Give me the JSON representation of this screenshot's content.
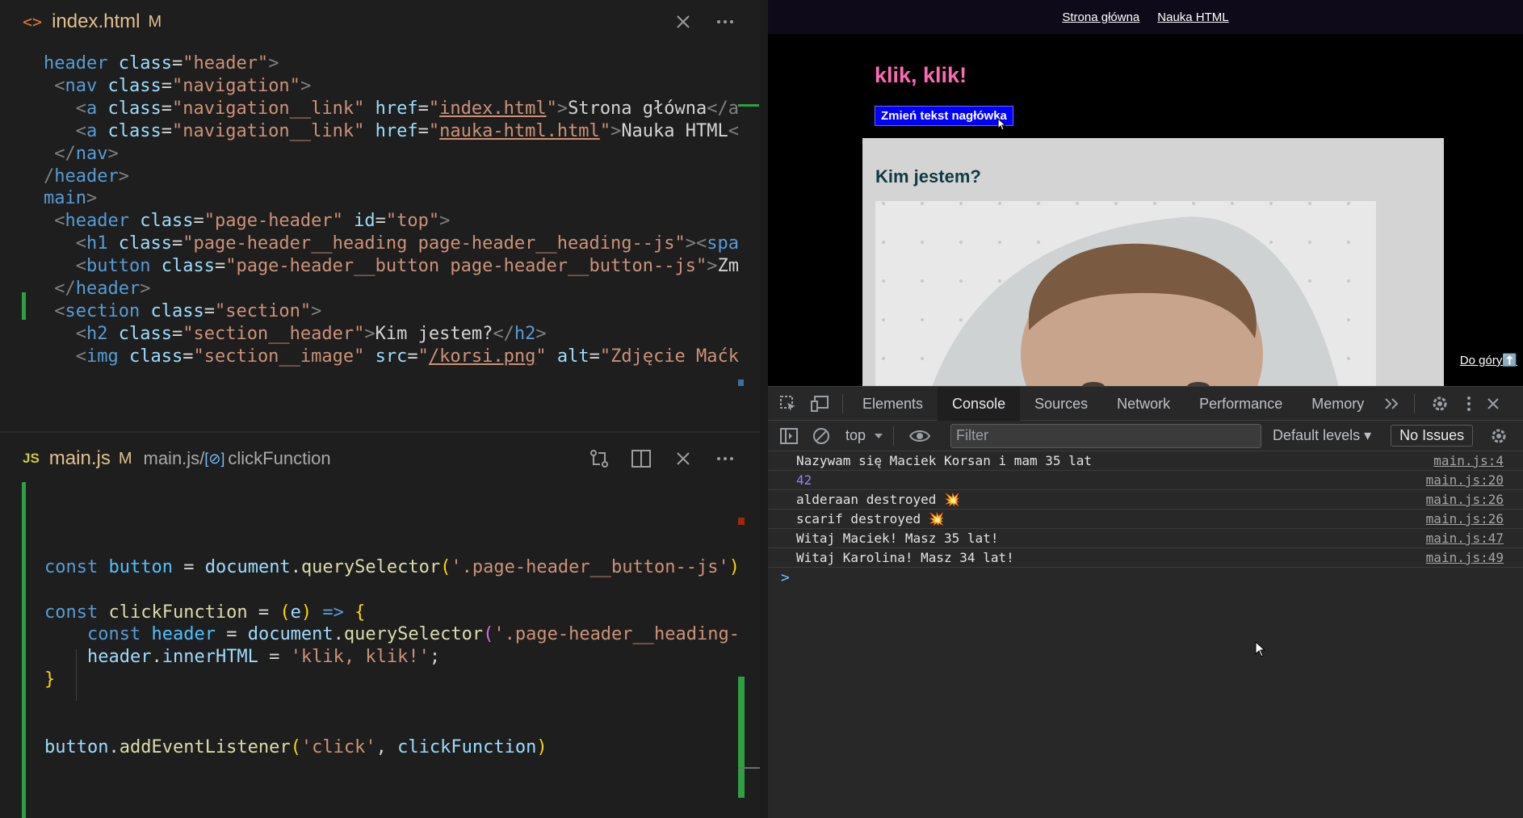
{
  "editor_top": {
    "file_name": "index.html",
    "modified_badge": "M",
    "lines": [
      [
        [
          "t",
          "header"
        ],
        [
          "x",
          " "
        ],
        [
          "a",
          "class"
        ],
        [
          "x",
          "="
        ],
        [
          "s",
          "\"header\""
        ],
        [
          "p",
          ">"
        ]
      ],
      [
        [
          "p",
          " <"
        ],
        [
          "t",
          "nav"
        ],
        [
          "x",
          " "
        ],
        [
          "a",
          "class"
        ],
        [
          "x",
          "="
        ],
        [
          "s",
          "\"navigation\""
        ],
        [
          "p",
          ">"
        ]
      ],
      [
        [
          "p",
          "   <"
        ],
        [
          "t",
          "a"
        ],
        [
          "x",
          " "
        ],
        [
          "a",
          "class"
        ],
        [
          "x",
          "="
        ],
        [
          "s",
          "\"navigation__link\""
        ],
        [
          "x",
          " "
        ],
        [
          "a",
          "href"
        ],
        [
          "x",
          "="
        ],
        [
          "s",
          "\""
        ],
        [
          "su",
          "index.html"
        ],
        [
          "s",
          "\""
        ],
        [
          "p",
          ">"
        ],
        [
          "x",
          "Strona główna"
        ],
        [
          "p",
          "</a"
        ]
      ],
      [
        [
          "p",
          "   <"
        ],
        [
          "t",
          "a"
        ],
        [
          "x",
          " "
        ],
        [
          "a",
          "class"
        ],
        [
          "x",
          "="
        ],
        [
          "s",
          "\"navigation__link\""
        ],
        [
          "x",
          " "
        ],
        [
          "a",
          "href"
        ],
        [
          "x",
          "="
        ],
        [
          "s",
          "\""
        ],
        [
          "su",
          "nauka-html.html"
        ],
        [
          "s",
          "\""
        ],
        [
          "p",
          ">"
        ],
        [
          "x",
          "Nauka HTML"
        ],
        [
          "p",
          "<"
        ]
      ],
      [
        [
          "p",
          " </"
        ],
        [
          "t",
          "nav"
        ],
        [
          "p",
          ">"
        ]
      ],
      [
        [
          "p",
          "/"
        ],
        [
          "t",
          "header"
        ],
        [
          "p",
          ">"
        ]
      ],
      [
        [
          "t",
          "main"
        ],
        [
          "p",
          ">"
        ]
      ],
      [
        [
          "p",
          " <"
        ],
        [
          "t",
          "header"
        ],
        [
          "x",
          " "
        ],
        [
          "a",
          "class"
        ],
        [
          "x",
          "="
        ],
        [
          "s",
          "\"page-header\""
        ],
        [
          "x",
          " "
        ],
        [
          "a",
          "id"
        ],
        [
          "x",
          "="
        ],
        [
          "s",
          "\"top\""
        ],
        [
          "p",
          ">"
        ]
      ],
      [
        [
          "p",
          "   <"
        ],
        [
          "t",
          "h1"
        ],
        [
          "x",
          " "
        ],
        [
          "a",
          "class"
        ],
        [
          "x",
          "="
        ],
        [
          "s",
          "\"page-header__heading page-header__heading--js\""
        ],
        [
          "p",
          "><"
        ],
        [
          "t",
          "spa"
        ]
      ],
      [
        [
          "p",
          "   <"
        ],
        [
          "t",
          "button"
        ],
        [
          "x",
          " "
        ],
        [
          "a",
          "class"
        ],
        [
          "x",
          "="
        ],
        [
          "s",
          "\"page-header__button page-header__button--js\""
        ],
        [
          "p",
          ">"
        ],
        [
          "x",
          "Zm"
        ]
      ],
      [
        [
          "p",
          " </"
        ],
        [
          "t",
          "header"
        ],
        [
          "p",
          ">"
        ]
      ],
      [
        [
          "p",
          " <"
        ],
        [
          "t",
          "section"
        ],
        [
          "x",
          " "
        ],
        [
          "a",
          "class"
        ],
        [
          "x",
          "="
        ],
        [
          "s",
          "\"section\""
        ],
        [
          "p",
          ">"
        ]
      ],
      [
        [
          "p",
          "   <"
        ],
        [
          "t",
          "h2"
        ],
        [
          "x",
          " "
        ],
        [
          "a",
          "class"
        ],
        [
          "x",
          "="
        ],
        [
          "s",
          "\"section__header\""
        ],
        [
          "p",
          ">"
        ],
        [
          "x",
          "Kim jestem?"
        ],
        [
          "p",
          "</"
        ],
        [
          "t",
          "h2"
        ],
        [
          "p",
          ">"
        ]
      ],
      [
        [
          "p",
          "   <"
        ],
        [
          "t",
          "img"
        ],
        [
          "x",
          " "
        ],
        [
          "a",
          "class"
        ],
        [
          "x",
          "="
        ],
        [
          "s",
          "\"section__image\""
        ],
        [
          "x",
          " "
        ],
        [
          "a",
          "src"
        ],
        [
          "x",
          "="
        ],
        [
          "s",
          "\""
        ],
        [
          "su",
          "/korsi.png"
        ],
        [
          "s",
          "\""
        ],
        [
          "x",
          " "
        ],
        [
          "a",
          "alt"
        ],
        [
          "x",
          "="
        ],
        [
          "s",
          "\"Zdjęcie Maćk"
        ]
      ]
    ]
  },
  "editor_bottom": {
    "lang_badge": "JS",
    "file_name": "main.js",
    "modified_badge": "M",
    "breadcrumb_file": "main.js",
    "breadcrumb_separator": "/",
    "breadcrumb_symbol": "clickFunction",
    "lines": [
      [],
      [],
      [],
      [
        [
          "k",
          "const"
        ],
        [
          "x",
          " "
        ],
        [
          "v",
          "button"
        ],
        [
          "x",
          " = "
        ],
        [
          "vv",
          "document"
        ],
        [
          "x",
          "."
        ],
        [
          "f",
          "querySelector"
        ],
        [
          "br",
          "("
        ],
        [
          "s",
          "'.page-header__button--js'"
        ],
        [
          "br",
          ")"
        ]
      ],
      [],
      [
        [
          "k",
          "const"
        ],
        [
          "x",
          " "
        ],
        [
          "f",
          "clickFunction"
        ],
        [
          "x",
          " = "
        ],
        [
          "br",
          "("
        ],
        [
          "vv",
          "e"
        ],
        [
          "br",
          ")"
        ],
        [
          "x",
          " "
        ],
        [
          "k",
          "=>"
        ],
        [
          "x",
          " "
        ],
        [
          "br",
          "{"
        ]
      ],
      [
        [
          "x",
          "    "
        ],
        [
          "k",
          "const"
        ],
        [
          "x",
          " "
        ],
        [
          "v",
          "header"
        ],
        [
          "x",
          " = "
        ],
        [
          "vv",
          "document"
        ],
        [
          "x",
          "."
        ],
        [
          "f",
          "querySelector"
        ],
        [
          "br2",
          "("
        ],
        [
          "s",
          "'.page-header__heading-"
        ]
      ],
      [
        [
          "x",
          "    "
        ],
        [
          "vv",
          "header"
        ],
        [
          "x",
          "."
        ],
        [
          "vv",
          "innerHTML"
        ],
        [
          "x",
          " = "
        ],
        [
          "s",
          "'klik, klik!'"
        ],
        [
          "x",
          ";"
        ]
      ],
      [
        [
          "br",
          "}"
        ]
      ],
      [],
      [],
      [
        [
          "vv",
          "button"
        ],
        [
          "x",
          "."
        ],
        [
          "f",
          "addEventListener"
        ],
        [
          "br",
          "("
        ],
        [
          "s",
          "'click'"
        ],
        [
          "x",
          ", "
        ],
        [
          "vv",
          "clickFunction"
        ],
        [
          "br",
          ")"
        ]
      ]
    ]
  },
  "browser": {
    "nav_links": [
      "Strona główna",
      "Nauka HTML"
    ],
    "heading": "klik, klik!",
    "button_label": "Zmień tekst nagłówka",
    "section_title": "Kim jestem?",
    "back_to_top": "Do góry⬆️"
  },
  "devtools": {
    "tabs": [
      "Elements",
      "Console",
      "Sources",
      "Network",
      "Performance",
      "Memory"
    ],
    "active_tab": "Console",
    "context": "top",
    "filter_placeholder": "Filter",
    "levels": "Default levels",
    "issues": "No Issues",
    "console": [
      {
        "msg": "Nazywam się Maciek Korsan i mam 35 lat",
        "src": "main.js:4",
        "type": "text"
      },
      {
        "msg": "42",
        "src": "main.js:20",
        "type": "number"
      },
      {
        "msg": "alderaan destroyed 💥",
        "src": "main.js:26",
        "type": "text"
      },
      {
        "msg": "scarif destroyed 💥",
        "src": "main.js:26",
        "type": "text"
      },
      {
        "msg": "Witaj Maciek! Masz 35 lat!",
        "src": "main.js:47",
        "type": "text"
      },
      {
        "msg": "Witaj Karolina! Masz 34 lat!",
        "src": "main.js:49",
        "type": "text"
      }
    ],
    "prompt": ">"
  },
  "colors": {
    "editor_bg": "#1e1e1e",
    "accent_pink": "#ff69b4",
    "button_blue": "#0000ff",
    "modified": "#e2c08d"
  }
}
